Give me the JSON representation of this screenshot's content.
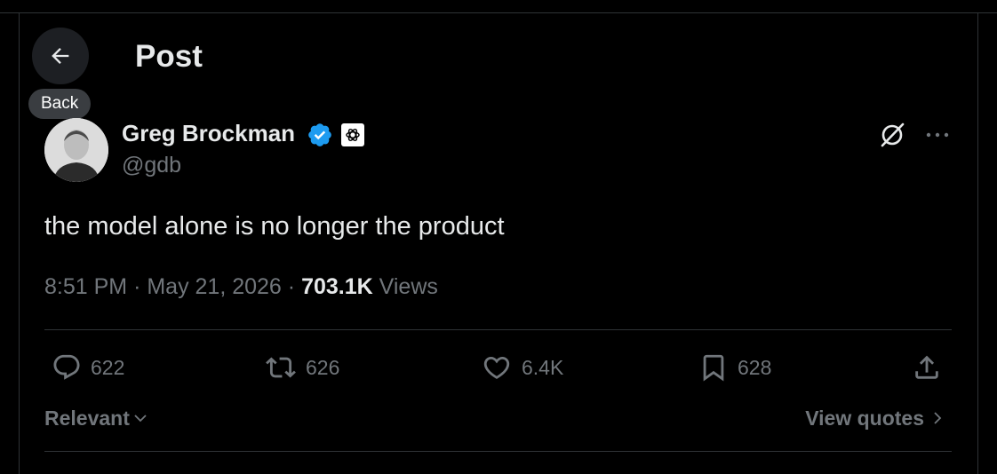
{
  "header": {
    "title": "Post",
    "back_tooltip": "Back"
  },
  "post": {
    "author_name": "Greg Brockman",
    "handle": "@gdb",
    "text": "the model alone is no longer the product",
    "time": "8:51 PM",
    "date": "May 21, 2026",
    "separator": "·",
    "views_count": "703.1K",
    "views_label": "Views"
  },
  "actions": {
    "replies": "622",
    "reposts": "626",
    "likes": "6.4K",
    "bookmarks": "628"
  },
  "footer": {
    "sort_label": "Relevant",
    "view_quotes_label": "View quotes"
  },
  "icons": {
    "back": "arrow-left-icon",
    "verified": "verified-badge-icon",
    "org": "openai-logo-icon",
    "grok": "grok-icon",
    "more": "more-horizontal-icon",
    "reply": "reply-icon",
    "repost": "repost-icon",
    "like": "heart-icon",
    "bookmark": "bookmark-icon",
    "share": "share-icon"
  },
  "colors": {
    "background": "#000000",
    "text_primary": "#e7e9ea",
    "text_secondary": "#71767b",
    "verified_blue": "#1d9bf0",
    "divider": "#2f3336"
  }
}
